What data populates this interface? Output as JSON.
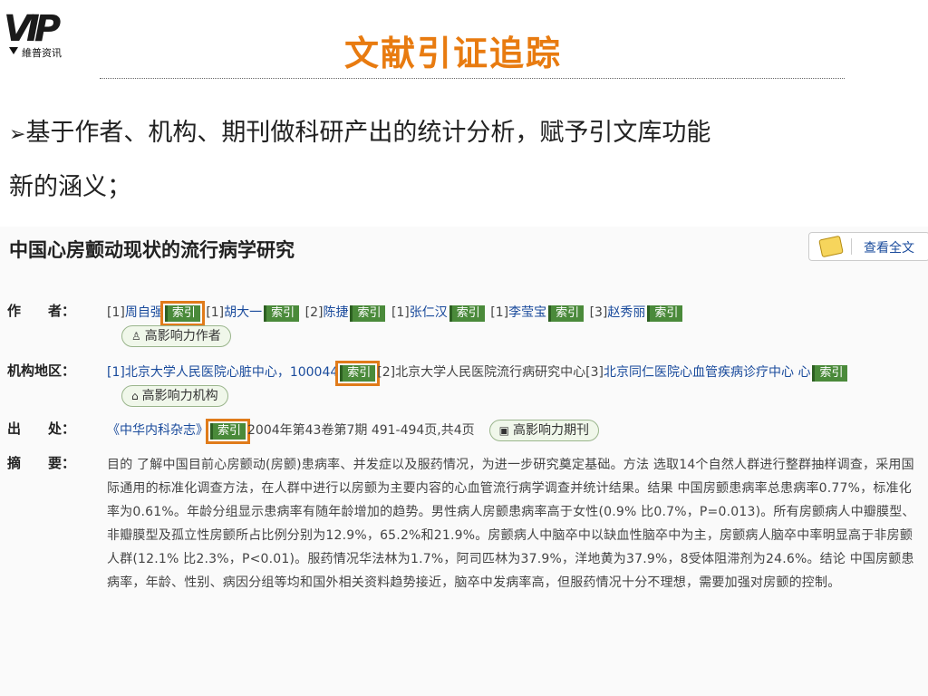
{
  "logo": {
    "mark": "VIP",
    "subtitle": "維普资讯"
  },
  "slide": {
    "title": "文献引证追踪",
    "bullet_line1": "基于作者、机构、期刊做科研产出的统计分析，赋予引文库功能",
    "bullet_line2": "新的涵义；"
  },
  "article": {
    "title": "中国心房颤动现状的流行病学研究",
    "fulltext_label": "查看全文",
    "index_tag": "索引",
    "authors_label": "作　　者：",
    "authors": [
      {
        "prefix": "[1]",
        "name": "周自强"
      },
      {
        "prefix": "[1]",
        "name": "胡大一"
      },
      {
        "prefix": "[2]",
        "name": "陈捷"
      },
      {
        "prefix": "[1]",
        "name": "张仁汉"
      },
      {
        "prefix": "[1]",
        "name": "李莹宝"
      },
      {
        "prefix": "[3]",
        "name": "赵秀丽"
      }
    ],
    "high_impact_author": "高影响力作者",
    "org_label": "机构地区：",
    "org1": "[1]北京大学人民医院心脏中心，100044",
    "org2": "[2]北京大学人民医院流行病研究中心",
    "org3_prefix": "[3]",
    "org3": "北京同仁医院心血管疾病诊疗中心",
    "org3_tail": "心",
    "high_impact_org": "高影响力机构",
    "source_label": "出　　处：",
    "journal": "《中华内科杂志》",
    "source_info": "2004年第43卷第7期 491-494页,共4页",
    "high_impact_journal": "高影响力期刊",
    "abstract_label": "摘　　要：",
    "abstract": "目的 了解中国目前心房颤动(房颤)患病率、并发症以及服药情况，为进一步研究奠定基础。方法 选取14个自然人群进行整群抽样调查，采用国际通用的标准化调查方法，在人群中进行以房颤为主要内容的心血管流行病学调查并统计结果。结果 中国房颤患病率总患病率0.77%，标准化率为0.61%。年龄分组显示患病率有随年龄增加的趋势。男性病人房颤患病率高于女性(0.9% 比0.7%，P=0.013)。所有房颤病人中瓣膜型、非瓣膜型及孤立性房颤所占比例分别为12.9%，65.2%和21.9%。房颤病人中脑卒中以缺血性脑卒中为主，房颤病人脑卒中率明显高于非房颤人群(12.1% 比2.3%，P<0.01)。服药情况华法林为1.7%，阿司匹林为37.9%，洋地黄为37.9%，8受体阻滞剂为24.6%。结论 中国房颤患病率，年龄、性别、病因分组等均和国外相关资料趋势接近，脑卒中发病率高，但服药情况十分不理想，需要加强对房颤的控制。"
  }
}
